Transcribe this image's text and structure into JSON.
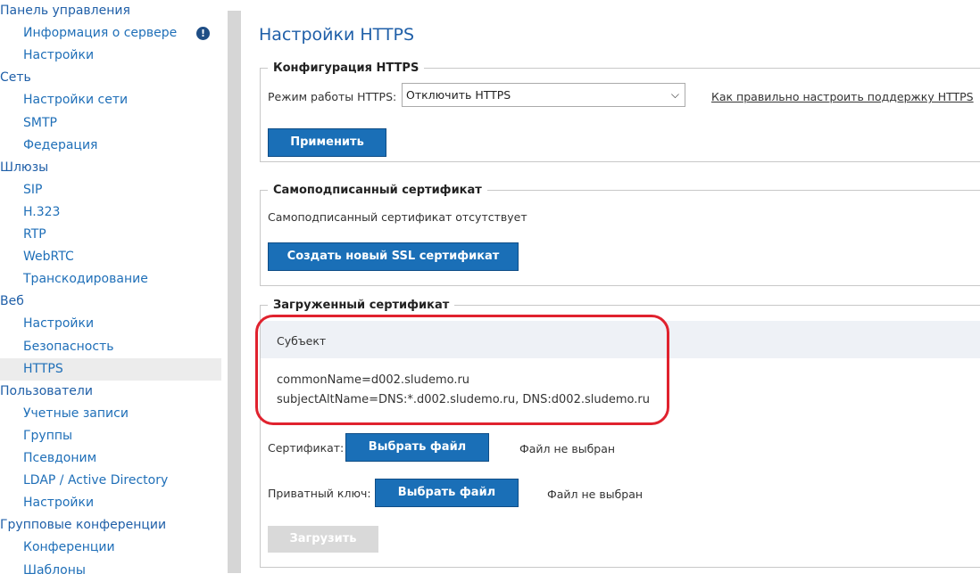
{
  "sidebar": {
    "rows": [
      {
        "label": "Панель управления",
        "level": "group"
      },
      {
        "label": "Информация о сервере",
        "level": "item"
      },
      {
        "label": "Настройки",
        "level": "item"
      },
      {
        "label": "Сеть",
        "level": "group"
      },
      {
        "label": "Настройки сети",
        "level": "item"
      },
      {
        "label": "SMTP",
        "level": "item"
      },
      {
        "label": "Федерация",
        "level": "item"
      },
      {
        "label": "Шлюзы",
        "level": "group"
      },
      {
        "label": "SIP",
        "level": "item"
      },
      {
        "label": "H.323",
        "level": "item"
      },
      {
        "label": "RTP",
        "level": "item"
      },
      {
        "label": "WebRTC",
        "level": "item"
      },
      {
        "label": "Транскодирование",
        "level": "item"
      },
      {
        "label": "Веб",
        "level": "group"
      },
      {
        "label": "Настройки",
        "level": "item"
      },
      {
        "label": "Безопасность",
        "level": "item"
      },
      {
        "label": "HTTPS",
        "level": "item",
        "active": true
      },
      {
        "label": "Пользователи",
        "level": "group"
      },
      {
        "label": "Учетные записи",
        "level": "item"
      },
      {
        "label": "Группы",
        "level": "item"
      },
      {
        "label": "Псевдоним",
        "level": "item"
      },
      {
        "label": "LDAP / Active Directory",
        "level": "item"
      },
      {
        "label": "Настройки",
        "level": "item"
      },
      {
        "label": "Групповые конференции",
        "level": "group"
      },
      {
        "label": "Конференции",
        "level": "item"
      },
      {
        "label": "Шаблоны",
        "level": "item"
      }
    ],
    "alert_icon": "exclamation-icon",
    "alert_glyph": "!"
  },
  "main": {
    "title": "Настройки HTTPS",
    "https_config": {
      "legend": "Конфигурация HTTPS",
      "mode_label": "Режим работы HTTPS:",
      "mode_value": "Отключить HTTPS",
      "help_link": "Как правильно настроить поддержку HTTPS",
      "apply_button": "Применить"
    },
    "self_signed": {
      "legend": "Самоподписанный сертификат",
      "status": "Самоподписанный сертификат отсутствует",
      "create_button": "Создать новый SSL сертификат"
    },
    "uploaded": {
      "legend": "Загруженный сертификат",
      "subject_header": "Субъект",
      "common_name": "commonName=d002.sludemo.ru",
      "alt_name": "subjectAltName=DNS:*.d002.sludemo.ru, DNS:d002.sludemo.ru",
      "cert_label": "Сертификат:",
      "key_label": "Приватный ключ:",
      "choose_button": "Выбрать файл",
      "no_file": "Файл не выбран",
      "upload_button": "Загрузить"
    }
  },
  "colors": {
    "accent": "#1a6fb7",
    "link": "#1f6fb8",
    "highlight": "#e0222e"
  }
}
